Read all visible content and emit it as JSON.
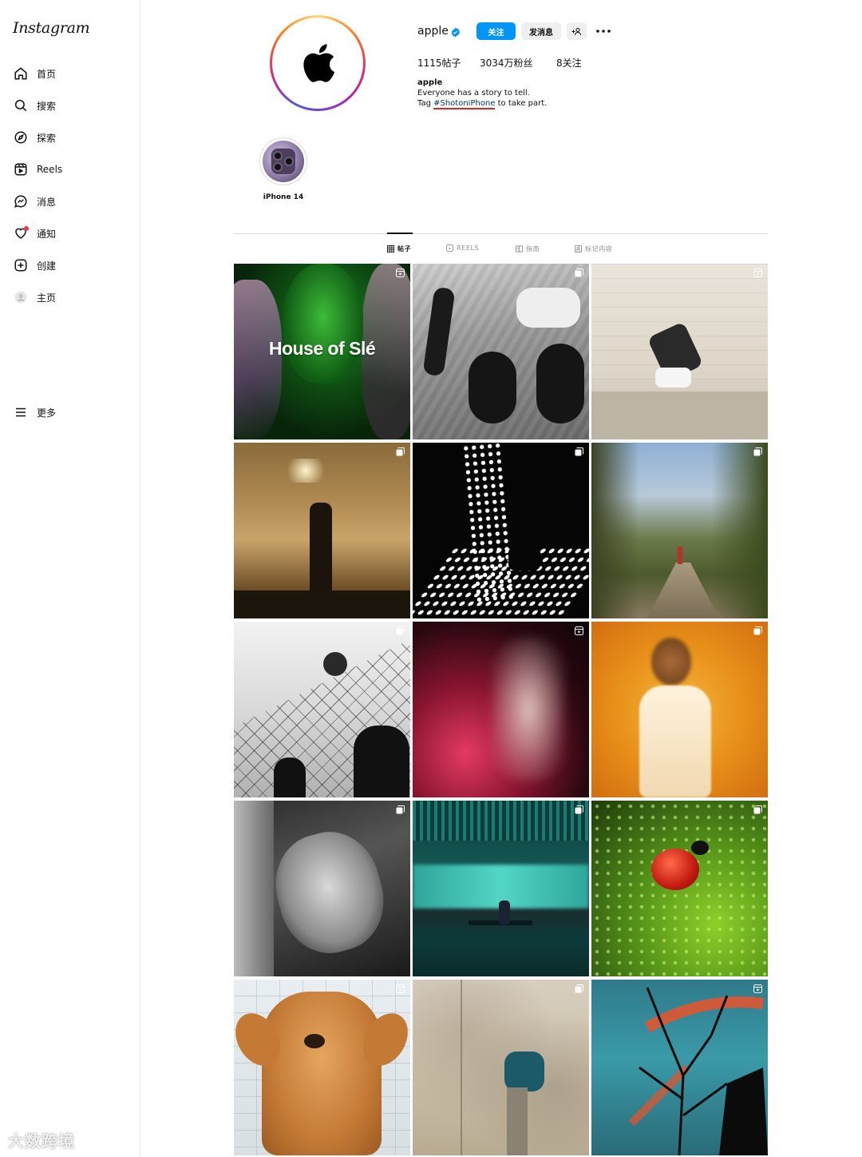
{
  "app": {
    "logo_text": "Instagram"
  },
  "sidebar": {
    "items": [
      {
        "label": "首页",
        "icon": "home-icon"
      },
      {
        "label": "搜索",
        "icon": "search-icon"
      },
      {
        "label": "探索",
        "icon": "compass-icon"
      },
      {
        "label": "Reels",
        "icon": "reels-icon"
      },
      {
        "label": "消息",
        "icon": "messenger-icon"
      },
      {
        "label": "通知",
        "icon": "heart-icon"
      },
      {
        "label": "创建",
        "icon": "plus-square-icon"
      },
      {
        "label": "主页",
        "icon": "avatar-icon"
      }
    ],
    "more_label": "更多"
  },
  "profile": {
    "username": "apple",
    "follow_label": "关注",
    "message_label": "发消息",
    "posts": "1115帖子",
    "followers": "3034万粉丝",
    "following": "8关注",
    "bio_name": "apple",
    "bio_line1": "Everyone has a story to tell.",
    "bio_tag_prefix": "Tag ",
    "bio_hashtag": "#ShotoniPhone",
    "bio_tag_suffix": " to take part.",
    "verified_color": "#0095f6",
    "follow_color": "#0095f6"
  },
  "highlights": [
    {
      "label": "iPhone 14"
    }
  ],
  "tabs": [
    {
      "label": "帖子",
      "active": true,
      "icon": "grid-icon"
    },
    {
      "label": "REELS",
      "active": false,
      "icon": "reels-icon"
    },
    {
      "label": "指南",
      "active": false,
      "icon": "guide-icon"
    },
    {
      "label": "标记内容",
      "active": false,
      "icon": "tag-icon"
    }
  ],
  "posts": [
    {
      "overlay_text": "House of Slé",
      "badge": "reel-icon"
    },
    {
      "overlay_text": "",
      "badge": "carousel-icon"
    },
    {
      "overlay_text": "",
      "badge": "reel-icon"
    },
    {
      "overlay_text": "",
      "badge": "carousel-icon"
    },
    {
      "overlay_text": "",
      "badge": "carousel-icon"
    },
    {
      "overlay_text": "",
      "badge": "carousel-icon"
    },
    {
      "overlay_text": "",
      "badge": "carousel-icon"
    },
    {
      "overlay_text": "",
      "badge": "reel-icon"
    },
    {
      "overlay_text": "",
      "badge": "carousel-icon"
    },
    {
      "overlay_text": "",
      "badge": "carousel-icon"
    },
    {
      "overlay_text": "",
      "badge": "carousel-icon"
    },
    {
      "overlay_text": "",
      "badge": "carousel-icon"
    },
    {
      "overlay_text": "",
      "badge": "reel-icon"
    },
    {
      "overlay_text": "",
      "badge": "carousel-icon"
    },
    {
      "overlay_text": "",
      "badge": "reel-icon"
    }
  ],
  "watermark": "大数跨境"
}
